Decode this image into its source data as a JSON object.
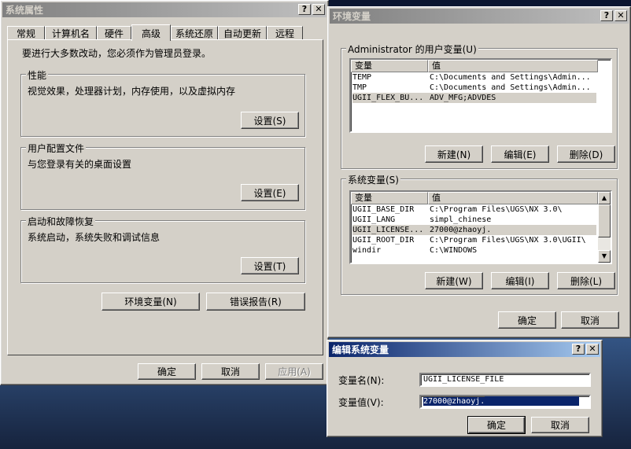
{
  "sysprops": {
    "title": "系统属性",
    "tabs": [
      "常规",
      "计算机名",
      "硬件",
      "高级",
      "系统还原",
      "自动更新",
      "远程"
    ],
    "admin_note": "要进行大多数改动，您必须作为管理员登录。",
    "perf": {
      "label": "性能",
      "desc": "视觉效果，处理器计划，内存使用，以及虚拟内存",
      "button": "设置(S)"
    },
    "profile": {
      "label": "用户配置文件",
      "desc": "与您登录有关的桌面设置",
      "button": "设置(E)"
    },
    "startup": {
      "label": "启动和故障恢复",
      "desc": "系统启动，系统失败和调试信息",
      "button": "设置(T)"
    },
    "env_button": "环境变量(N)",
    "error_button": "错误报告(R)",
    "ok": "确定",
    "cancel": "取消",
    "apply": "应用(A)"
  },
  "envvars": {
    "title": "环境变量",
    "user_group": "Administrator 的用户变量(U)",
    "col_var": "变量",
    "col_val": "值",
    "user_rows": [
      {
        "name": "TEMP",
        "value": "C:\\Documents and Settings\\Admin..."
      },
      {
        "name": "TMP",
        "value": "C:\\Documents and Settings\\Admin..."
      },
      {
        "name": "UGII_FLEX_BU...",
        "value": "ADV_MFG;ADVDES"
      }
    ],
    "user_new": "新建(N)",
    "user_edit": "编辑(E)",
    "user_delete": "删除(D)",
    "sys_group": "系统变量(S)",
    "sys_rows": [
      {
        "name": "UGII_BASE_DIR",
        "value": "C:\\Program Files\\UGS\\NX 3.0\\"
      },
      {
        "name": "UGII_LANG",
        "value": "simpl_chinese"
      },
      {
        "name": "UGII_LICENSE...",
        "value": "27000@zhaoyj."
      },
      {
        "name": "UGII_ROOT_DIR",
        "value": "C:\\Program Files\\UGS\\NX 3.0\\UGII\\"
      },
      {
        "name": "windir",
        "value": "C:\\WINDOWS"
      }
    ],
    "sys_new": "新建(W)",
    "sys_edit": "编辑(I)",
    "sys_delete": "删除(L)",
    "ok": "确定",
    "cancel": "取消"
  },
  "editvar": {
    "title": "编辑系统变量",
    "name_label": "变量名(N):",
    "name_value": "UGII_LICENSE_FILE",
    "value_label": "变量值(V):",
    "value_value": "27000@zhaoyj.",
    "ok": "确定",
    "cancel": "取消"
  }
}
